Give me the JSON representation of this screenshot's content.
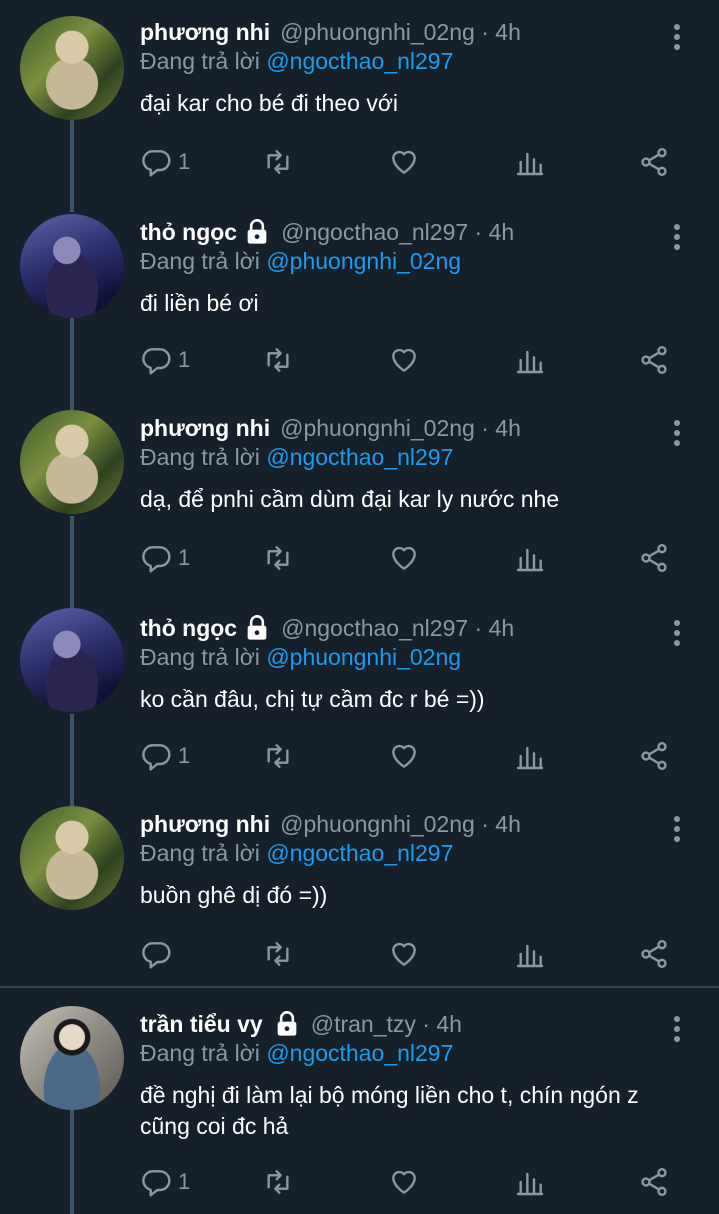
{
  "colors": {
    "background": "#15202b",
    "mention": "#1d9bf0",
    "muted": "#8899a6",
    "thread_line": "#3d5466"
  },
  "tweets": [
    {
      "name": "phương nhi",
      "locked": false,
      "handle": "@phuongnhi_02ng · 4h",
      "replying_prefix": "Đang trả lời ",
      "replying_to": "@ngocthao_nl297",
      "lines": [
        "đại kar cho bé đi theo với"
      ],
      "reply_count": "1",
      "avatar": "avatar-phuong-nhi"
    },
    {
      "name": "thỏ ngọc",
      "locked": true,
      "handle": "@ngocthao_nl297 · 4h",
      "replying_prefix": "Đang trả lời ",
      "replying_to": "@phuongnhi_02ng",
      "lines": [
        "đi liền bé ơi"
      ],
      "reply_count": "1",
      "avatar": "avatar-tho-ngoc"
    },
    {
      "name": "phương nhi",
      "locked": false,
      "handle": "@phuongnhi_02ng · 4h",
      "replying_prefix": "Đang trả lời ",
      "replying_to": "@ngocthao_nl297",
      "lines": [
        "dạ, để pnhi cầm dùm đại kar ly nước nhe"
      ],
      "reply_count": "1",
      "avatar": "avatar-phuong-nhi"
    },
    {
      "name": "thỏ ngọc",
      "locked": true,
      "handle": "@ngocthao_nl297 · 4h",
      "replying_prefix": "Đang trả lời ",
      "replying_to": "@phuongnhi_02ng",
      "lines": [
        "ko cần đâu, chị tự cầm đc r bé =))"
      ],
      "reply_count": "1",
      "avatar": "avatar-tho-ngoc"
    },
    {
      "name": "phương nhi",
      "locked": false,
      "handle": "@phuongnhi_02ng · 4h",
      "replying_prefix": "Đang trả lời ",
      "replying_to": "@ngocthao_nl297",
      "lines": [
        "buồn ghê dị đó =))"
      ],
      "reply_count": "",
      "avatar": "avatar-phuong-nhi"
    },
    {
      "name": "trần tiểu vy",
      "locked": true,
      "handle": "@tran_tzy · 4h",
      "replying_prefix": "Đang trả lời ",
      "replying_to": "@ngocthao_nl297",
      "lines": [
        "đề nghị đi làm lại bộ móng liền cho t, chín ngón z",
        "cũng coi đc hả"
      ],
      "reply_count": "1",
      "avatar": "avatar-tran-tieu-vy"
    }
  ]
}
